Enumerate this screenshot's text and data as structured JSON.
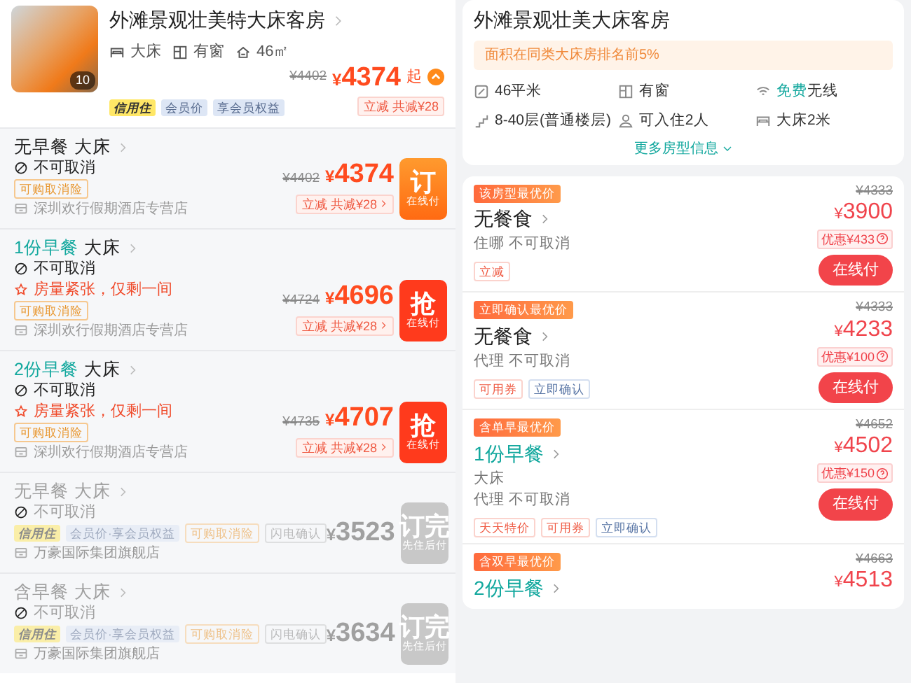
{
  "room_header": {
    "photo_count": "10",
    "title": "外滩景观壮美特大床客房",
    "expanded": true,
    "features": [
      {
        "kind": "bed",
        "label": "大床"
      },
      {
        "kind": "window",
        "label": "有窗"
      },
      {
        "kind": "house",
        "label": "46㎡"
      }
    ],
    "tags": [
      {
        "kind": "credit",
        "label": "信用住"
      },
      {
        "kind": "member",
        "label": "会员价"
      },
      {
        "kind": "member",
        "label": "享会员权益"
      }
    ],
    "original_price": "¥4402",
    "price": "¥4374",
    "price_suffix": "起",
    "discount": "立减 共减¥28"
  },
  "rate_plans": [
    {
      "meal": "无早餐",
      "kind": "none",
      "bed": "大床",
      "cancel": "不可取消",
      "sold_out": false,
      "tags": [
        {
          "kind": "insurance",
          "label": "可购取消险"
        }
      ],
      "store": "深圳欢行假期酒店专营店",
      "original_price": "¥4402",
      "price": "¥4374",
      "discount": "立减 共减¥28",
      "button": {
        "kind": "book",
        "label": "订",
        "sub": "在线付"
      }
    },
    {
      "meal": "1份早餐",
      "kind": "breakfast",
      "bed": "大床",
      "cancel": "不可取消",
      "urgency": "房量紧张，仅剩一间",
      "sold_out": false,
      "tags": [
        {
          "kind": "insurance",
          "label": "可购取消险"
        }
      ],
      "store": "深圳欢行假期酒店专营店",
      "original_price": "¥4724",
      "price": "¥4696",
      "discount": "立减 共减¥28",
      "button": {
        "kind": "grab",
        "label": "抢",
        "sub": "在线付"
      }
    },
    {
      "meal": "2份早餐",
      "kind": "breakfast",
      "bed": "大床",
      "cancel": "不可取消",
      "urgency": "房量紧张，仅剩一间",
      "sold_out": false,
      "tags": [
        {
          "kind": "insurance",
          "label": "可购取消险"
        }
      ],
      "store": "深圳欢行假期酒店专营店",
      "original_price": "¥4735",
      "price": "¥4707",
      "discount": "立减 共减¥28",
      "button": {
        "kind": "grab",
        "label": "抢",
        "sub": "在线付"
      }
    },
    {
      "meal": "无早餐",
      "kind": "none",
      "bed": "大床",
      "cancel": "不可取消",
      "sold_out": true,
      "tags": [
        {
          "kind": "credit",
          "label": "信用住"
        },
        {
          "kind": "member",
          "label": "会员价·享会员权益"
        },
        {
          "kind": "insurance",
          "label": "可购取消险"
        },
        {
          "kind": "instant",
          "label": "闪电确认"
        }
      ],
      "store": "万豪国际集团旗舰店",
      "price": "¥3523",
      "button": {
        "kind": "sold_out",
        "label": "订完",
        "sub": "先住后付"
      }
    },
    {
      "meal": "含早餐",
      "kind": "none",
      "bed": "大床",
      "cancel": "不可取消",
      "sold_out": true,
      "tags": [
        {
          "kind": "credit",
          "label": "信用住"
        },
        {
          "kind": "member",
          "label": "会员价·享会员权益"
        },
        {
          "kind": "insurance",
          "label": "可购取消险"
        },
        {
          "kind": "instant",
          "label": "闪电确认"
        }
      ],
      "store": "万豪国际集团旗舰店",
      "price": "¥3634",
      "button": {
        "kind": "sold_out",
        "label": "订完",
        "sub": "先住后付"
      }
    }
  ],
  "room_detail": {
    "title": "外滩景观壮美大床客房",
    "highlight": "面积在同类大床房排名前5%",
    "facilities": [
      {
        "kind": "area",
        "label": "46平米"
      },
      {
        "kind": "window",
        "label": "有窗"
      },
      {
        "kind": "wifi",
        "highlight": "免费",
        "label": "无线"
      },
      {
        "kind": "floor",
        "label": "8-40层(普通楼层)"
      },
      {
        "kind": "person",
        "label": "可入住2人"
      },
      {
        "kind": "bed",
        "label": "大床2米"
      }
    ],
    "more_link": "更多房型信息"
  },
  "offers": [
    {
      "badge": "该房型最优价",
      "meal": "无餐食",
      "kind": "none",
      "provider": "住哪 不可取消",
      "tags": [
        {
          "kind": "promo",
          "label": "立减"
        }
      ],
      "original_price": "¥4333",
      "price": "¥3900",
      "saving": "优惠¥433",
      "button": "在线付"
    },
    {
      "badge": "立即确认最优价",
      "meal": "无餐食",
      "kind": "none",
      "provider": "代理 不可取消",
      "tags": [
        {
          "kind": "promo",
          "label": "可用券"
        },
        {
          "kind": "confirm",
          "label": "立即确认"
        }
      ],
      "original_price": "¥4333",
      "price": "¥4233",
      "saving": "优惠¥100",
      "button": "在线付"
    },
    {
      "badge": "含单早最优价",
      "meal": "1份早餐",
      "kind": "breakfast",
      "bed": "大床",
      "provider": "代理 不可取消",
      "tags": [
        {
          "kind": "promo",
          "label": "天天特价"
        },
        {
          "kind": "promo",
          "label": "可用券"
        },
        {
          "kind": "confirm",
          "label": "立即确认"
        }
      ],
      "original_price": "¥4652",
      "price": "¥4502",
      "saving": "优惠¥150",
      "button": "在线付"
    },
    {
      "badge": "含双早最优价",
      "meal": "2份早餐",
      "kind": "breakfast",
      "original_price": "¥4663",
      "price": "¥4513"
    }
  ]
}
